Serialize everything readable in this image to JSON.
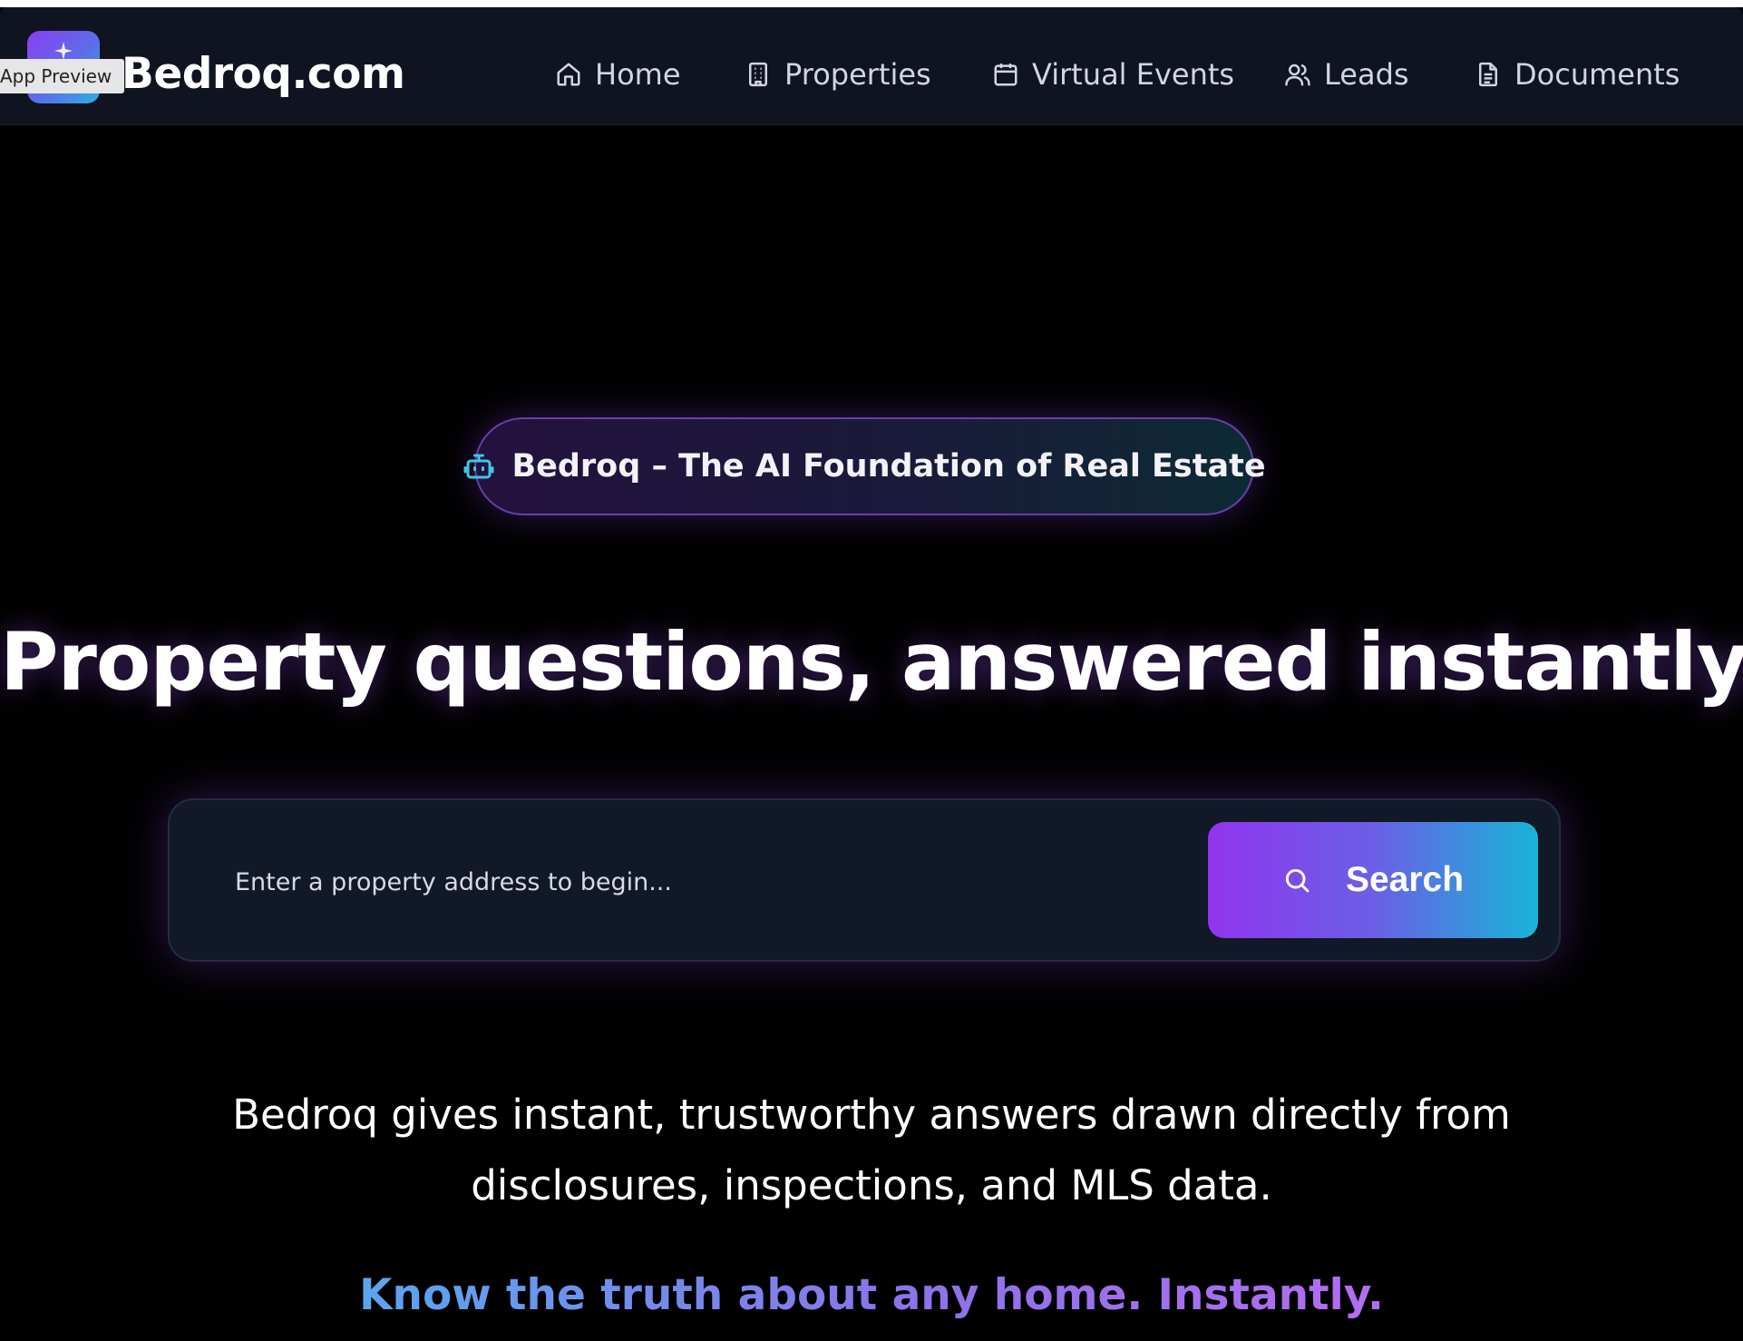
{
  "preview_tag": "App Preview",
  "header": {
    "brand": "Bedroq.com",
    "logo_icon": "spark-icon"
  },
  "nav": {
    "items": [
      {
        "label": "Home",
        "icon": "home-icon"
      },
      {
        "label": "Properties",
        "icon": "building-icon"
      },
      {
        "label": "Virtual Events",
        "icon": "calendar-icon"
      },
      {
        "label": "Leads",
        "icon": "users-icon"
      },
      {
        "label": "Documents",
        "icon": "document-icon"
      }
    ]
  },
  "hero": {
    "badge_icon": "robot-icon",
    "badge": "Bedroq – The AI Foundation of Real Estate",
    "headline": "Property questions, answered instantly.",
    "search": {
      "placeholder": "Enter a property address to begin...",
      "value": "",
      "button_label": "Search",
      "button_icon": "search-icon"
    },
    "description": "Bedroq gives instant, trustworthy answers drawn directly from disclosures, inspections, and MLS data.",
    "tagline": "Know the truth about any home. Instantly."
  },
  "colors": {
    "background": "#000000",
    "navbar": "#0f1420",
    "accent_purple": "#9135ee",
    "accent_cyan": "#19b4d6",
    "badge_icon": "#3ec8e6"
  }
}
